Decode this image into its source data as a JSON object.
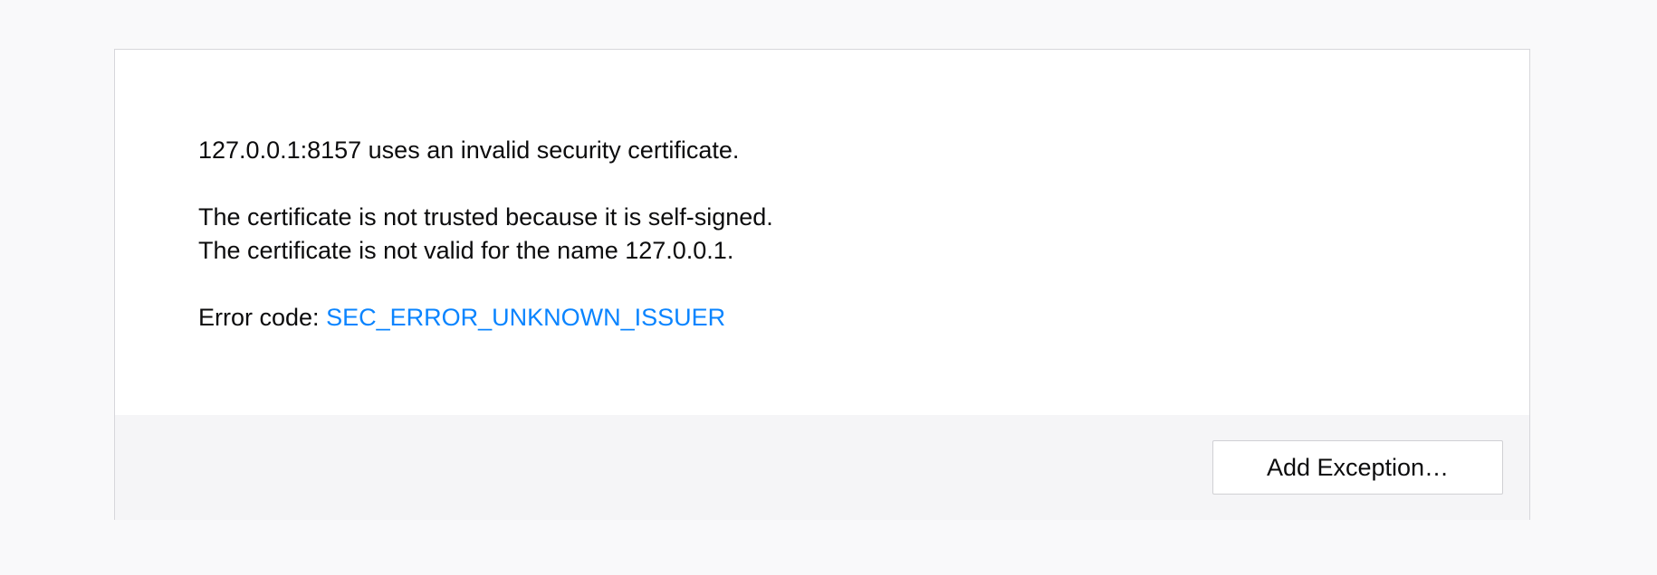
{
  "message": {
    "headline": "127.0.0.1:8157 uses an invalid security certificate.",
    "reason_1": "The certificate is not trusted because it is self-signed.",
    "reason_2": "The certificate is not valid for the name 127.0.0.1.",
    "error_label": "Error code: ",
    "error_code": "SEC_ERROR_UNKNOWN_ISSUER"
  },
  "footer": {
    "add_exception_label": "Add Exception…"
  },
  "colors": {
    "link": "#0a84ff",
    "footer_bg": "#f5f5f7",
    "page_bg": "#f9f9fa"
  }
}
